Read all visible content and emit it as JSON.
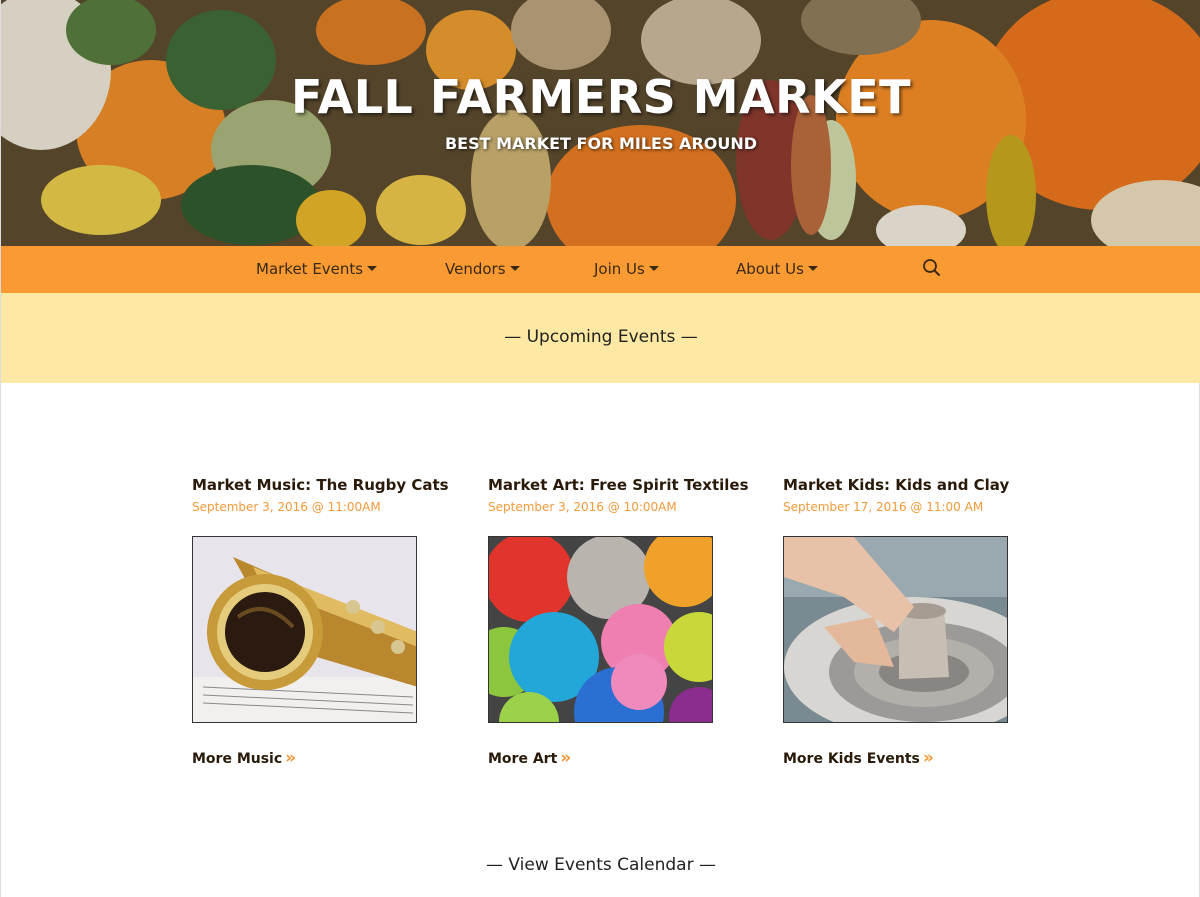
{
  "header": {
    "title": "FALL FARMERS MARKET",
    "tagline": "BEST MARKET FOR MILES AROUND"
  },
  "nav": {
    "items": [
      {
        "label": "Market Events"
      },
      {
        "label": "Vendors"
      },
      {
        "label": "Join Us"
      },
      {
        "label": "About Us"
      }
    ],
    "search_icon": "search-icon"
  },
  "upcoming": {
    "heading": "— Upcoming Events —"
  },
  "events": [
    {
      "title": "Market Music: The Rugby Cats",
      "date": "September 3, 2016 @ 11:00AM",
      "more": "More Music",
      "image": "saxophone-photo"
    },
    {
      "title": "Market Art: Free Spirit Textiles",
      "date": "September 3, 2016 @ 10:00AM",
      "more": "More Art",
      "image": "yarn-photo"
    },
    {
      "title": "Market Kids: Kids and Clay",
      "date": "September 17, 2016 @ 11:00 AM",
      "more": "More Kids Events",
      "image": "pottery-photo"
    }
  ],
  "footer": {
    "calendar_link": "— View Events Calendar —"
  },
  "colors": {
    "nav_bg": "#fa9a33",
    "band_bg": "#fde9a3",
    "accent": "#f29a3a",
    "text_dark": "#2a1a0a"
  }
}
